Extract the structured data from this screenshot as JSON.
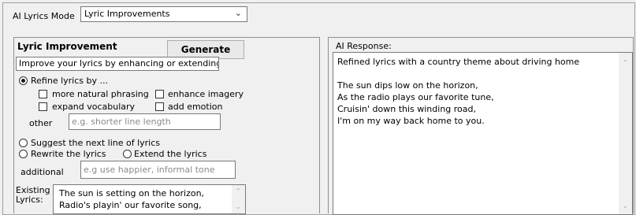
{
  "mode": {
    "label": "AI Lyrics Mode",
    "selected": "Lyric Improvements"
  },
  "left": {
    "title": "Lyric Improvement",
    "generate_label": "Generate",
    "mode_value": "Improve your lyrics by enhancing or extending",
    "refine_label": "Refine lyrics by ...",
    "checkboxes": [
      {
        "label": "more natural phrasing"
      },
      {
        "label": "enhance imagery"
      },
      {
        "label": "expand vocabulary"
      },
      {
        "label": "add emotion"
      }
    ],
    "other_label": "other",
    "other_placeholder": "e.g. shorter line length",
    "suggest_label": "Suggest the next line of lyrics",
    "rewrite_label": "Rewrite the lyrics",
    "extend_label": "Extend the lyrics",
    "additional_label": "additional",
    "additional_placeholder": "e.g use happier, informal tone",
    "existing_label_1": "Existing",
    "existing_label_2": "Lyrics:",
    "existing_lines": [
      "The sun is setting on the horizon,",
      "Radio's playin' our favorite song,"
    ]
  },
  "right": {
    "label": "AI Response:",
    "lines": [
      "Refined lyrics with a country theme about driving home",
      "",
      "The sun dips low on the horizon,",
      "As the radio plays our favorite tune,",
      "Cruisin' down this winding road,",
      "I'm on my way back home to you."
    ]
  }
}
